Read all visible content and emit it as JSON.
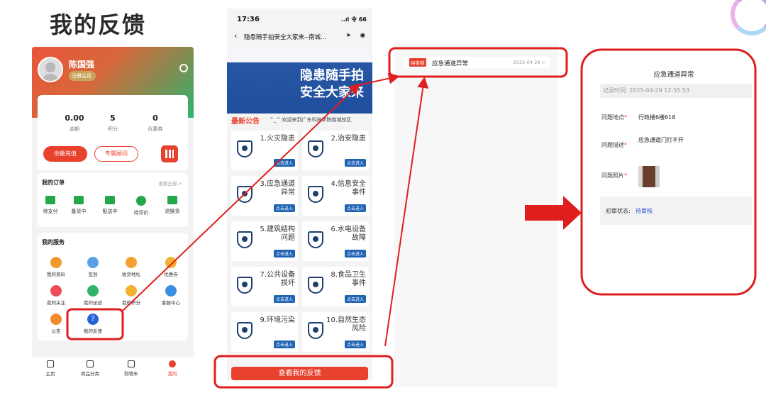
{
  "page_title": "我的反馈",
  "profile": {
    "name": "陈国强",
    "member_badge": "注册会员",
    "stats": [
      {
        "value": "0.00",
        "label": "余额"
      },
      {
        "value": "5",
        "label": "积分"
      },
      {
        "value": "0",
        "label": "优惠券"
      }
    ],
    "recharge_label": "余额充值",
    "advisor_label": "专属顾问"
  },
  "orders": {
    "title": "我的订单",
    "see_all": "查看全部 >",
    "items": [
      "待支付",
      "备货中",
      "配送中",
      "待评价",
      "退换货"
    ]
  },
  "services": {
    "title": "我的服务",
    "items": [
      {
        "label": "我的资料",
        "color": "#f29a2e"
      },
      {
        "label": "签到",
        "color": "#5aa0e6"
      },
      {
        "label": "收货地址",
        "color": "#f2a030"
      },
      {
        "label": "优惠券",
        "color": "#f2b230"
      },
      {
        "label": "我的关注",
        "color": "#ec4b5a"
      },
      {
        "label": "我的足迹",
        "color": "#2fb36a"
      },
      {
        "label": "我的积分",
        "color": "#f2b230"
      },
      {
        "label": "客服中心",
        "color": "#3a8fe0"
      },
      {
        "label": "公告",
        "color": "#f28a2e"
      },
      {
        "label": "我的反馈",
        "color": "#2563d6"
      }
    ]
  },
  "tabbar": [
    "主页",
    "商品分类",
    "购物车",
    "我的"
  ],
  "phone": {
    "time": "17:36",
    "signal": "..ıl 令 66",
    "nav_title": "隐患随手拍安全大家来--南城...",
    "banner_line1": "隐患随手拍",
    "banner_line2": "安全大家来",
    "notice_title": "最新公告",
    "notice_text": "^_^ 欢迎来到广东科技学院南城校区",
    "enter_label": "点击进入",
    "categories": [
      "1.火灾隐患",
      "2.治安隐患",
      "3.应急通道异常",
      "4.信息安全事件",
      "5.建筑结构问题",
      "6.水电设备故障",
      "7.公共设备损坏",
      "8.食品卫生事件",
      "9.环境污染",
      "10.自然生态风险"
    ],
    "view_feedback": "查看我的反馈"
  },
  "feedback_list": {
    "status_tag": "待审核",
    "title": "应急通道异常",
    "date": "2025-04-29 >"
  },
  "detail": {
    "title": "应急通道异常",
    "record_time": "记录时间: 2025-04-29 12:55:53",
    "location_label": "问题地点",
    "location_value": "行政楼6楼618",
    "desc_label": "问题描述",
    "desc_value": "应急通道门打不开",
    "photo_label": "问题照片",
    "review_label": "初审状态:",
    "review_value": "待审核",
    "review_color": "#2a4fd6"
  },
  "colors": {
    "accent_red": "#e8412e",
    "annotation_red": "#e01e1e",
    "green": "#25a84a",
    "navy": "#1d3f6e"
  }
}
